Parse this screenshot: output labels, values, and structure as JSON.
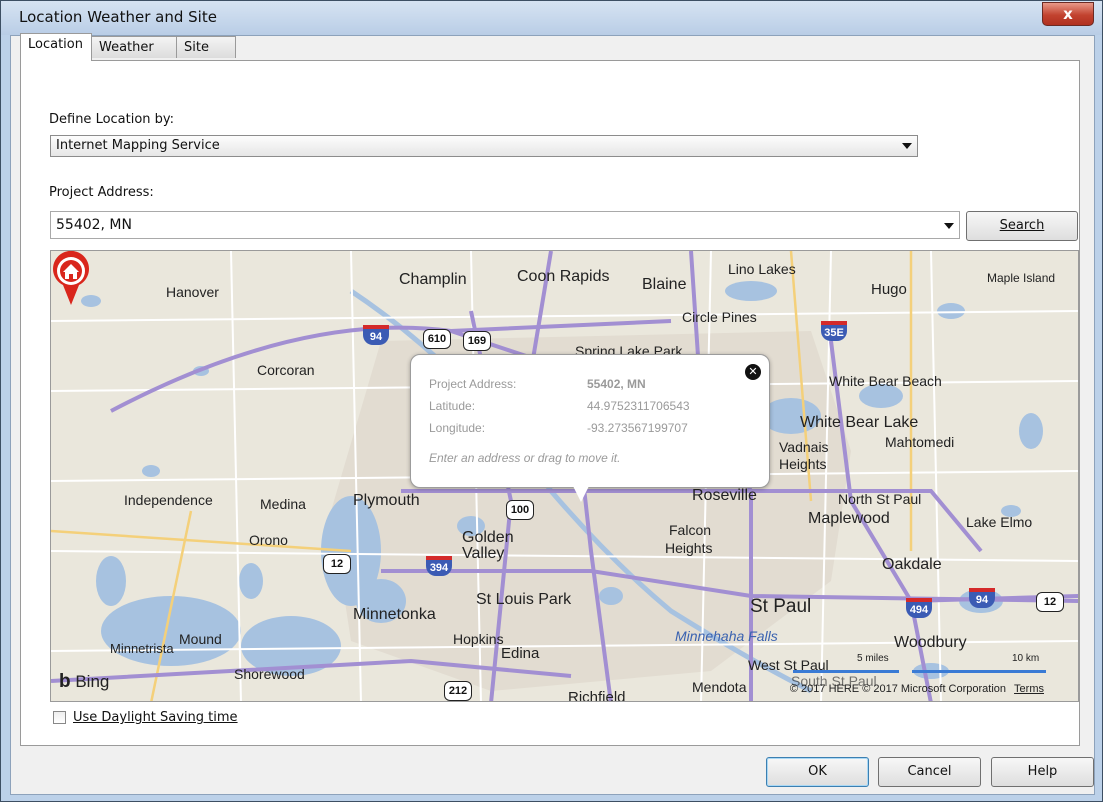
{
  "window": {
    "title": "Location Weather and Site",
    "close_label": "x"
  },
  "tabs": [
    {
      "label": "Location",
      "active": true
    },
    {
      "label": "Weather",
      "active": false
    },
    {
      "label": "Site",
      "active": false
    }
  ],
  "location": {
    "define_label": "Define Location by:",
    "define_value": "Internet Mapping Service",
    "address_label": "Project Address:",
    "address_value": "55402, MN",
    "search_label": "Search"
  },
  "map": {
    "brand": "Bing",
    "labels": [
      "Champlin",
      "Coon Rapids",
      "Blaine",
      "Lino Lakes",
      "Maple Island",
      "Hanover",
      "Hugo",
      "Circle Pines",
      "Spring Lake Park",
      "Corcoran",
      "White Bear Beach",
      "White Bear Lake",
      "Vadnais",
      "Heights",
      "Mahtomedi",
      "Independence",
      "Medina",
      "Plymouth",
      "Roseville",
      "North St Paul",
      "Maplewood",
      "Lake Elmo",
      "Orono",
      "Golden",
      "Valley",
      "Falcon",
      "Heights",
      "Oakdale",
      "St Louis Park",
      "Minnetonka",
      "Mound",
      "St Paul",
      "Hopkins",
      "Minnehaha Falls",
      "Woodbury",
      "Minnetrista",
      "Edina",
      "West St Paul",
      "Shorewood",
      "Richfield",
      "Mendota",
      "South St Paul"
    ],
    "highways": [
      "94",
      "610",
      "169",
      "35E",
      "100",
      "12",
      "394",
      "494",
      "94",
      "12",
      "212"
    ],
    "popup": {
      "address_label": "Project Address:",
      "address_value": "55402, MN",
      "lat_label": "Latitude:",
      "lat_value": "44.9752311706543",
      "lon_label": "Longitude:",
      "lon_value": "-93.273567199707",
      "hint": "Enter an address or drag to move it."
    },
    "copyright": "© 2017 HERE © 2017 Microsoft Corporation",
    "terms": "Terms",
    "scale_miles": "5 miles",
    "scale_km": "10 km"
  },
  "daylight": {
    "label": "Use Daylight Saving time",
    "checked": false
  },
  "buttons": {
    "ok": "OK",
    "cancel": "Cancel",
    "help": "Help"
  }
}
